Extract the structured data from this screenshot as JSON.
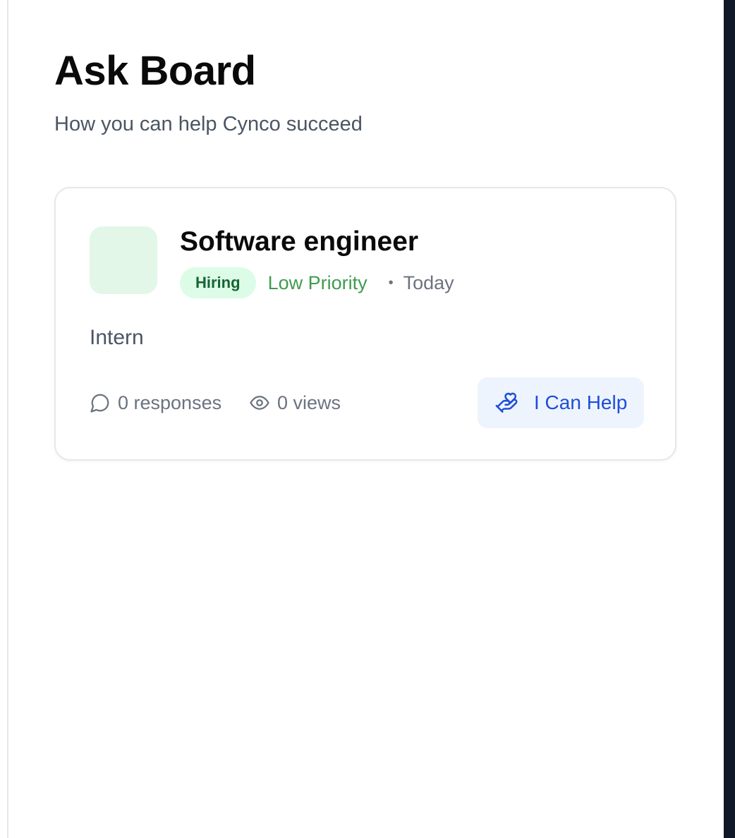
{
  "page": {
    "title": "Ask Board",
    "subtitle": "How you can help Cynco succeed"
  },
  "asks": [
    {
      "title": "Software engineer",
      "category": "Hiring",
      "priority": "Low Priority",
      "separator": "•",
      "posted": "Today",
      "description": "Intern",
      "responses_label": "0 responses",
      "views_label": "0 views",
      "help_label": "I Can Help"
    }
  ],
  "colors": {
    "accent_blue": "#1d4ed8",
    "help_button_bg": "#eef4fd",
    "category_badge_bg": "#dcfce7",
    "category_badge_text": "#166534",
    "priority_low": "#3f9b4f",
    "avatar_bg": "#e2f7e7",
    "sidebar_dark": "#111827"
  },
  "icons": {
    "responses": "message-circle-icon",
    "views": "eye-icon",
    "help": "hand-heart-icon"
  }
}
